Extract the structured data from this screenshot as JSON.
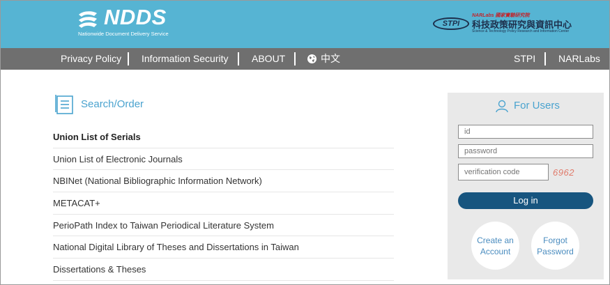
{
  "header": {
    "logo_text": "NDDS",
    "logo_subtitle": "Nationwide Document Delivery Service",
    "stpi_badge": "STPI",
    "stpi_nar": "NARLabs 國家實驗研究院",
    "stpi_name_cn": "科技政策研究與資訊中心",
    "stpi_name_en": "Science & Technology Policy Research and Information Center",
    "bg_color": "#56b4d3"
  },
  "nav": {
    "items": [
      "Privacy Policy",
      "Information Security",
      "ABOUT",
      "中文"
    ],
    "right_items": [
      "STPI",
      "NARLabs"
    ],
    "bg_color": "#6f6f6f"
  },
  "search": {
    "title": "Search/Order",
    "links": [
      "Union List of Serials",
      "Union List of Electronic Journals",
      "NBINet (National Bibliographic Information Network)",
      "METACAT+",
      "PerioPath Index to Taiwan Periodical Literature System",
      "National Digital Library of Theses and Dissertations in Taiwan",
      "Dissertations & Theses"
    ]
  },
  "login": {
    "title": "For Users",
    "id_placeholder": "id",
    "password_placeholder": "password",
    "verification_placeholder": "verification code",
    "captcha": "6962",
    "login_label": "Log in",
    "create_account_label": "Create an Account",
    "forgot_password_label": "Forgot Password",
    "accent_color": "#17557f"
  }
}
